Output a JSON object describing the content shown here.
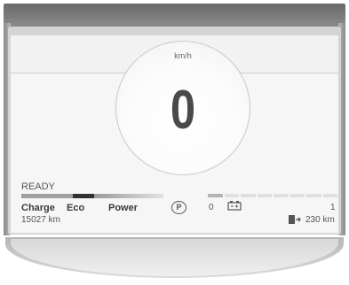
{
  "speedometer": {
    "unit": "km/h",
    "speed": "0"
  },
  "status": {
    "ready": "READY"
  },
  "power_meter": {
    "charge_label": "Charge",
    "eco_label": "Eco",
    "power_label": "Power",
    "value": "0"
  },
  "gear": {
    "park": "P"
  },
  "odometer": {
    "value": "15027 km"
  },
  "range": {
    "value": "230 km"
  },
  "battery": {
    "level": "1"
  },
  "colors": {
    "screen_bg": "#f6f6f6",
    "charge_segment": "#a0a0a0",
    "eco_segment": "#303030",
    "power_segment": "#cfcfcf"
  }
}
